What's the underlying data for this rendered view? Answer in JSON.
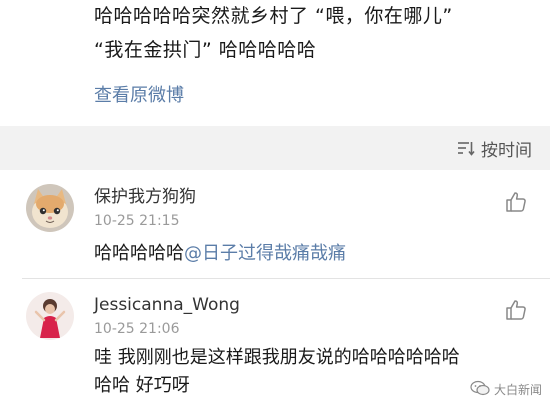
{
  "post": {
    "line1": "哈哈哈哈哈突然就乡村了 “喂，你在哪儿”",
    "line2": "“我在金拱门” 哈哈哈哈哈",
    "view_original": "查看原微博"
  },
  "sort": {
    "label": "按时间",
    "icon": "sort-icon"
  },
  "comments": [
    {
      "username": "保护我方狗狗",
      "time": "10-25 21:15",
      "text": "哈哈哈哈哈",
      "mention": "@日子过得哉痛哉痛",
      "avatar": "cat-avatar",
      "like_icon": "thumbs-up-icon"
    },
    {
      "username": "Jessicanna_Wong",
      "time": "10-25 21:06",
      "text_line1": "哇 我刚刚也是这样跟我朋友说的哈哈哈哈哈哈",
      "text_line2": "哈哈 好巧呀",
      "avatar": "girl-avatar",
      "like_icon": "thumbs-up-icon"
    }
  ],
  "watermark": {
    "text": "大白新闻",
    "icon": "wechat-icon"
  }
}
